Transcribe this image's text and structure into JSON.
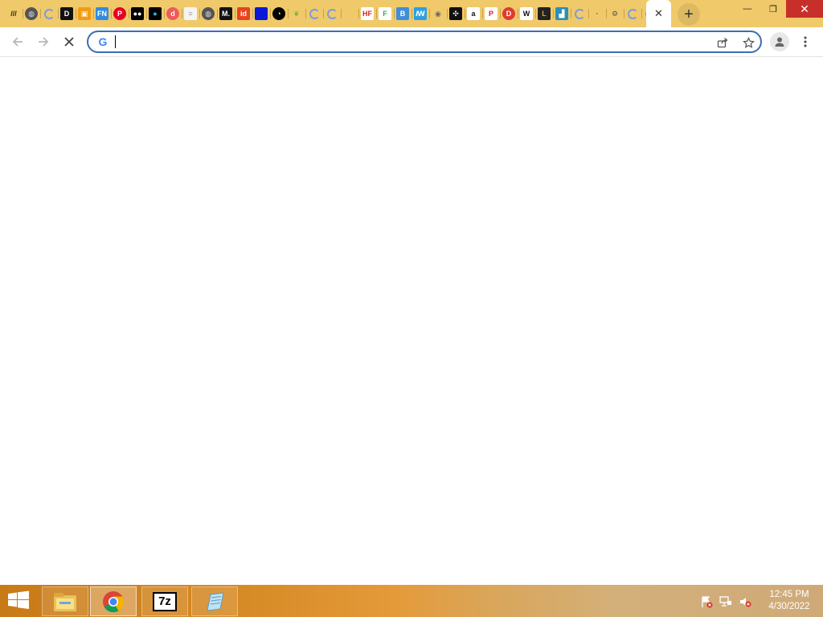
{
  "browser": {
    "tabs": [
      {
        "icon": "slashes-icon",
        "glyph": "///",
        "bg": "transparent",
        "fg": "#222"
      },
      {
        "icon": "globe-icon",
        "glyph": "◍",
        "bg": "#555",
        "fg": "#ddd",
        "shape": "ci"
      },
      {
        "icon": "loading-spinner-icon",
        "glyph": "",
        "shape": "sp"
      },
      {
        "icon": "d-logo-icon",
        "glyph": "D",
        "bg": "#111",
        "fg": "#fff",
        "shape": "sq"
      },
      {
        "icon": "image-icon",
        "glyph": "▣",
        "bg": "#f39c12",
        "fg": "#fff",
        "shape": "sq"
      },
      {
        "icon": "fn-logo-icon",
        "glyph": "FN",
        "bg": "#2f8ce0",
        "fg": "#fff",
        "shape": "sq"
      },
      {
        "icon": "pinterest-icon",
        "glyph": "P",
        "bg": "#e60023",
        "fg": "#fff",
        "shape": "ci"
      },
      {
        "icon": "medium-icon",
        "glyph": "●●",
        "bg": "#000",
        "fg": "#fff",
        "shape": "sq"
      },
      {
        "icon": "circle-logo-icon",
        "glyph": "●",
        "bg": "#000",
        "fg": "#2db3e6",
        "shape": "sq"
      },
      {
        "icon": "d-circle-icon",
        "glyph": "d",
        "bg": "#f05a5a",
        "fg": "#fff",
        "shape": "ci"
      },
      {
        "icon": "document-icon",
        "glyph": "≡",
        "bg": "#f4f4f4",
        "fg": "#aaa",
        "shape": "sq"
      },
      {
        "icon": "globe-icon",
        "glyph": "◍",
        "bg": "#555",
        "fg": "#ddd",
        "shape": "ci"
      },
      {
        "icon": "m-logo-icon",
        "glyph": "M.",
        "bg": "#111",
        "fg": "#fff",
        "shape": "sq"
      },
      {
        "icon": "id-logo-icon",
        "glyph": "id",
        "bg": "#e8431d",
        "fg": "#fff",
        "shape": "sq"
      },
      {
        "icon": "blue-square-icon",
        "glyph": "",
        "bg": "#0a18d8",
        "fg": "#fff",
        "shape": "sq"
      },
      {
        "icon": "pacman-logo-icon",
        "glyph": "◔",
        "bg": "#000",
        "fg": "#fff",
        "shape": "ci"
      },
      {
        "icon": "leaf-icon",
        "glyph": "❦",
        "bg": "transparent",
        "fg": "#6fb23f"
      },
      {
        "icon": "loading-spinner-icon",
        "glyph": "",
        "shape": "sp"
      },
      {
        "icon": "loading-spinner-icon",
        "glyph": "",
        "shape": "sp"
      },
      {
        "icon": "blank-icon",
        "glyph": "",
        "bg": "transparent",
        "fg": "#fff"
      },
      {
        "icon": "hf-logo-icon",
        "glyph": "HF",
        "bg": "#fff",
        "fg": "#d3281e",
        "shape": "sq"
      },
      {
        "icon": "f-logo-icon",
        "glyph": "F",
        "bg": "#fff",
        "fg": "#3aa55c",
        "shape": "sq"
      },
      {
        "icon": "b-logo-icon",
        "glyph": "B",
        "bg": "#3e8ed8",
        "fg": "#fff",
        "shape": "sq"
      },
      {
        "icon": "wave-logo-icon",
        "glyph": "ꟿ",
        "bg": "#2aa0e4",
        "fg": "#fff",
        "shape": "sq"
      },
      {
        "icon": "flame-icon",
        "glyph": "◉",
        "bg": "transparent",
        "fg": "#666"
      },
      {
        "icon": "compass-icon",
        "glyph": "✣",
        "bg": "#111",
        "fg": "#fff",
        "shape": "sq"
      },
      {
        "icon": "amazon-icon",
        "glyph": "a",
        "bg": "#fff",
        "fg": "#111",
        "shape": "sq"
      },
      {
        "icon": "p-target-icon",
        "glyph": "P",
        "bg": "#fff",
        "fg": "#d6222e",
        "shape": "sq"
      },
      {
        "icon": "d-red-icon",
        "glyph": "D",
        "bg": "#e03a2f",
        "fg": "#fff",
        "shape": "ci"
      },
      {
        "icon": "wikipedia-icon",
        "glyph": "W",
        "bg": "#fff",
        "fg": "#111",
        "shape": "sq"
      },
      {
        "icon": "l-logo-icon",
        "glyph": "L",
        "bg": "#222",
        "fg": "#e6a12b",
        "shape": "sq"
      },
      {
        "icon": "chart-icon",
        "glyph": "▟",
        "bg": "#2b8fb8",
        "fg": "#fff",
        "shape": "sq"
      },
      {
        "icon": "loading-spinner-icon",
        "glyph": "",
        "shape": "sp"
      },
      {
        "icon": "dot-icon",
        "glyph": "·",
        "bg": "transparent",
        "fg": "#555"
      },
      {
        "icon": "gear-icon",
        "glyph": "⚙",
        "bg": "transparent",
        "fg": "#555"
      },
      {
        "icon": "loading-spinner-icon",
        "glyph": "",
        "shape": "sp"
      },
      {
        "icon": "loading-spinner-icon",
        "glyph": "",
        "shape": "sp"
      }
    ],
    "active_tab": {
      "close_glyph": "✕"
    },
    "new_tab_glyph": "+",
    "window_controls": {
      "minimize": "—",
      "restore": "❐",
      "close": "✕"
    },
    "toolbar": {
      "back_icon": "arrow-left-icon",
      "forward_icon": "arrow-right-icon",
      "stop_icon": "stop-loading-icon",
      "google_glyph": "G",
      "address_value": "",
      "address_placeholder": ""
    }
  },
  "taskbar": {
    "apps": [
      {
        "name": "file-explorer-icon",
        "label": "File Explorer"
      },
      {
        "name": "chrome-icon",
        "label": "Google Chrome"
      },
      {
        "name": "7zip-icon",
        "label": "7z"
      },
      {
        "name": "notepad-icon",
        "label": "Notepad"
      }
    ],
    "seven_zip_text": "7z",
    "clock_time": "12:45 PM",
    "clock_date": "4/30/2022"
  },
  "colors": {
    "titlebar": "#f0c96a",
    "omnibox_border": "#3c6eb0",
    "taskbar_accent": "#d78b26"
  }
}
